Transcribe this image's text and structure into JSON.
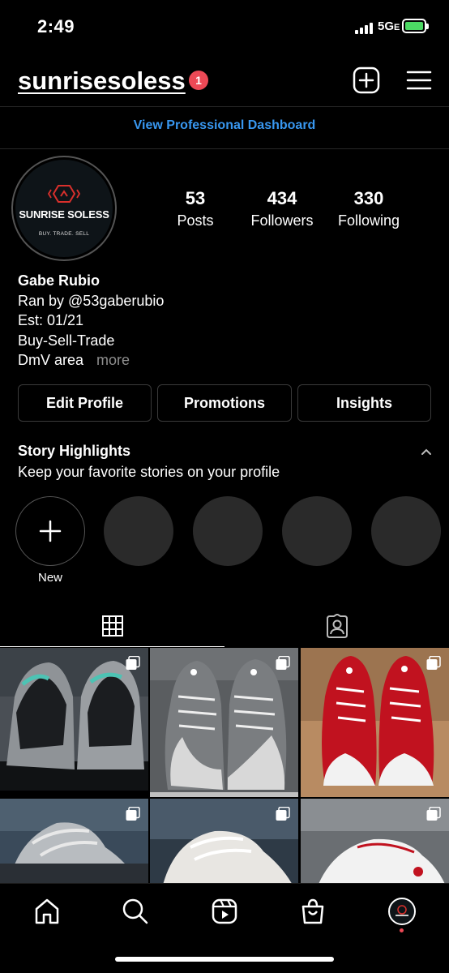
{
  "status_bar": {
    "time": "2:49",
    "network": "5G",
    "network_suffix": "E"
  },
  "header": {
    "username": "sunrisesoless",
    "notification_count": "1"
  },
  "professional_dashboard": {
    "label": "View Professional Dashboard",
    "color": "#3897f0"
  },
  "profile": {
    "avatar": {
      "brand": "SUNRISE SOLESS",
      "tagline": "BUY. TRADE. SELL"
    },
    "stats": [
      {
        "value": "53",
        "label": "Posts"
      },
      {
        "value": "434",
        "label": "Followers"
      },
      {
        "value": "330",
        "label": "Following"
      }
    ],
    "bio": {
      "name": "Gabe Rubio",
      "lines": [
        "Ran by @53gaberubio",
        "Est: 01/21",
        "Buy-Sell-Trade",
        "DmV area"
      ],
      "more": "more"
    }
  },
  "actions": {
    "edit_profile": "Edit Profile",
    "promotions": "Promotions",
    "insights": "Insights"
  },
  "highlights": {
    "title": "Story Highlights",
    "subtitle": "Keep your favorite stories on your profile",
    "new_label": "New"
  },
  "tabs": [
    {
      "icon": "grid-icon",
      "active": true
    },
    {
      "icon": "tagged-icon",
      "active": false
    }
  ],
  "posts": [
    {
      "description": "Air Jordan 10 sneakers on shoebox",
      "multiple": true
    },
    {
      "description": "Air Jordan 12 cool grey sneakers",
      "multiple": true
    },
    {
      "description": "Air Jordan 12 gym red sneakers",
      "multiple": true
    },
    {
      "description": "Yeezy grey sneakers",
      "multiple": true
    },
    {
      "description": "Yeezy white sneakers",
      "multiple": true
    },
    {
      "description": "White and red sneakers",
      "multiple": true
    }
  ],
  "bottom_nav": [
    {
      "icon": "home-icon"
    },
    {
      "icon": "search-icon"
    },
    {
      "icon": "reels-icon"
    },
    {
      "icon": "shop-icon"
    },
    {
      "icon": "profile-avatar"
    }
  ],
  "colors": {
    "accent": "#3897f0",
    "badge": "#ed4956",
    "battery": "#4cd964"
  }
}
